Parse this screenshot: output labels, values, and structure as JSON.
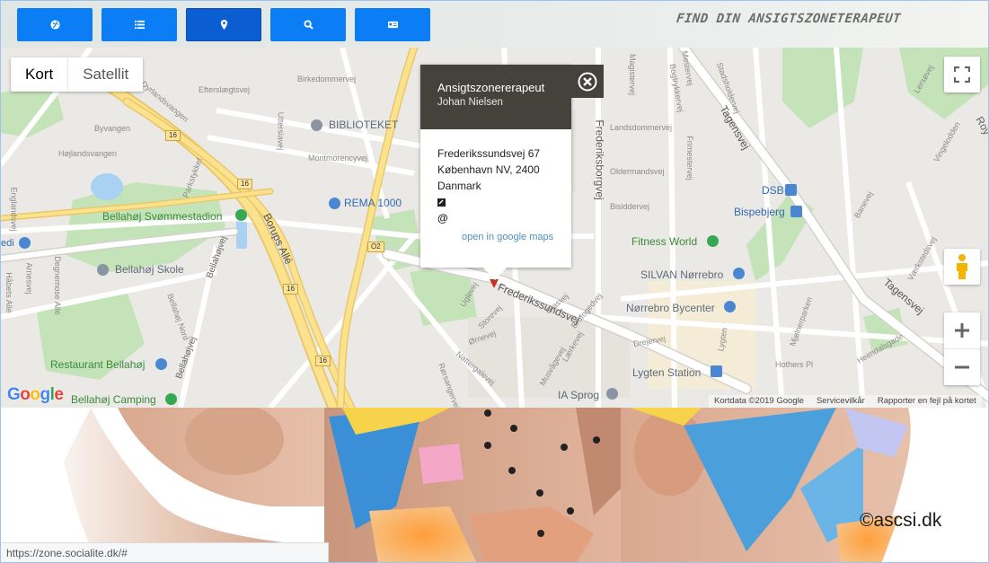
{
  "toolbar": {
    "buttons": [
      {
        "icon": "globe-icon",
        "active": false
      },
      {
        "icon": "list-icon",
        "active": false
      },
      {
        "icon": "map-pin-icon",
        "active": true
      },
      {
        "icon": "search-icon",
        "active": false
      },
      {
        "icon": "id-card-icon",
        "active": false
      }
    ],
    "site_title": "Find din ansigtszoneterapeut",
    "colors": {
      "button": "#0b7ef5",
      "button_active": "#0a5ed1"
    }
  },
  "map": {
    "map_type": {
      "map": "Kort",
      "satellite": "Satellit"
    },
    "info_window": {
      "title": "Ansigtszonererapeut",
      "name": "Johan Nielsen",
      "street": "Frederikssundsvej 67",
      "city": "København NV,  2400",
      "country": "Danmark",
      "email_symbol": "@",
      "link": "open in google maps"
    },
    "places": {
      "bibliotek": "BIBLIOTEKET",
      "rema": "REMA 1000",
      "svommestadion": "Bellahøj Svømmestadion",
      "skole": "Bellahøj Skole",
      "restaurant": "Restaurant Bellahøj",
      "camping": "Bellahøj Camping",
      "fitness": "Fitness World",
      "silvan": "SILVAN Nørrebro",
      "bycenter": "Nørrebro Bycenter",
      "lygten": "Lygten Station",
      "dsb": "DSB",
      "bispebjerg": "Bispebjerg",
      "iasprog": "IA Sprog"
    },
    "streets": {
      "frederikssundsvej": "Frederikssundsvej",
      "borups_alle": "Borups Allé",
      "frederiksborgvej": "Frederiksborgvej",
      "tagensvej": "Tagensvej",
      "tagensvej2": "Tagensvej",
      "bellahojvej": "Bellahøjvej",
      "bellahojvej2": "Bellahøjvej",
      "hojlandsvangen": "Højlandsvangen",
      "byvangen": "Byvangen",
      "efterslaegtsvej": "Efterslægtsvej",
      "birkedommervej": "Birkedommervej",
      "montmorencyvej": "Montmorencyvej",
      "landsdommervej": "Landsdommervej",
      "oldermandsvej": "Oldermandsvej",
      "bisiddervej": "Bisiddervej",
      "uttersiavej": "Uttersiavej",
      "dyrlandsvangen": "Dyrlandsvangen",
      "parkstykket": "Parkstykket",
      "degnemose": "Degnemose Allé",
      "habets": "Håbets Allé",
      "arnesvej": "Arnesvej",
      "ugleve": "Uglevej",
      "storevej": "Storevej",
      "ornevej": "Ørnevej",
      "nattergalevej": "Nattergalevej",
      "rorsangervej": "Rørsangervej",
      "musvagevej": "Musvågevej",
      "laerkevej": "Lærkevej",
      "glasvej": "Glasvej",
      "brofogedvej": "Brofogedvej",
      "drejervej": "Drejervej",
      "frimestervej": "Frimestervej",
      "lygten": "Lygten",
      "heimdalsgade": "Heimdalsgade",
      "hothers": "Hothers Pl",
      "bogtrykkervej": "Bogtrykkervej",
      "magistervej": "Magistervej",
      "mestervej": "Mestervej",
      "stadsholdervej": "Stadsholdervej",
      "vingelodden": "Vingelodden",
      "banevej": "Banevej",
      "ellebjerg": "Lersøvej",
      "vaerkstedsvej": "Værkstedsvej",
      "mjolnerparken": "Mjølnerparken",
      "bellahoj_nord": "Bellahøj Nord",
      "roy": "Roy",
      "englands": "Englandsvej",
      "arnesvej2": "Arnesvej"
    },
    "road_shields": [
      "16",
      "16",
      "16",
      "16",
      "16",
      "O2"
    ],
    "side_label": "edi",
    "attribution": {
      "data": "Kortdata ©2019 Google",
      "terms": "Servicevilkår",
      "report": "Rapporter en fejl på kortet"
    },
    "google_logo": "Google"
  },
  "strip": {
    "copyright": "©ascsi.dk"
  },
  "status_bar": {
    "url": "https://zone.socialite.dk/#"
  }
}
